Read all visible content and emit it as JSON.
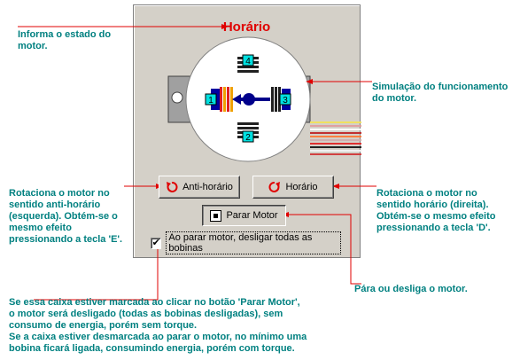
{
  "status": {
    "text": "Horário"
  },
  "buttons": {
    "anticlockwise": "Anti-horário",
    "clockwise": "Horário",
    "stop": "Parar Motor"
  },
  "checkbox": {
    "checked": true,
    "label": "Ao parar motor, desligar todas as bobinas"
  },
  "coils": [
    "1",
    "2",
    "3",
    "4"
  ],
  "annotations": {
    "status": "Informa o estado do\nmotor.",
    "simulation": "Simulação do funcionamento\ndo motor.",
    "anticlockwise": "Rotaciona o motor no\nsentido anti-horário\n(esquerda). Obtém-se o\nmesmo efeito\npressionando a tecla 'E'.",
    "clockwise": "Rotaciona o motor no\nsentido horário (direita).\nObtém-se o mesmo efeito\npressionando a tecla 'D'.",
    "stop": "Pára ou desliga o motor.",
    "checkbox": "Se essa caixa estiver marcada ao clicar no botão 'Parar Motor',\no motor será desligado (todas as bobinas desligadas), sem\nconsumo de energia, porém sem torque.\nSe a caixa estiver desmarcada ao parar o motor, no mínimo uma\nbobina ficará ligada, consumindo energia, porém com torque."
  },
  "colors": {
    "annotation": "#008080",
    "leader": "#e00000",
    "status": "#e00000"
  }
}
